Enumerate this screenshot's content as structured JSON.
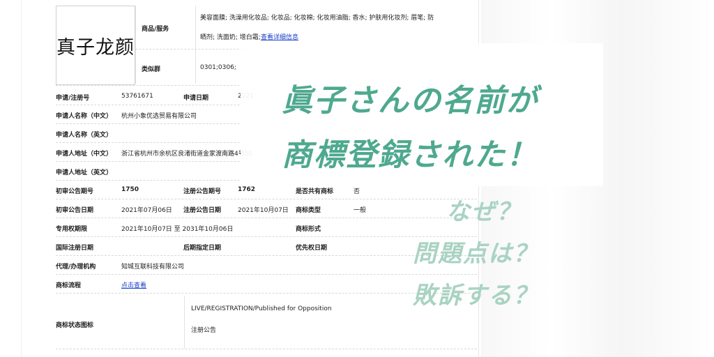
{
  "document": {
    "logo_text": "真子龙颜",
    "goods_label": "商品/服务",
    "goods_value_line1": "美容面膜; 洗澡用化妆品; 化妆品; 化妆棉; 化妆用油脂; 香水; 护肤用化妆剂; 眉笔; 防",
    "goods_value_line2": "晒剂; 洗面奶; 增白霜;",
    "goods_link": "查看详细信息",
    "class_label": "类似群",
    "class_value": "0301;0306;",
    "reg_no_label": "申请/注册号",
    "reg_no_value": "53761671",
    "app_date_label": "申请日期",
    "app_date_value": "2021",
    "applicant_cn_label": "申请人名称（中文）",
    "applicant_cn_value": "杭州小象优选贸易有限公司",
    "applicant_en_label": "申请人名称（英文）",
    "address_cn_label": "申请人地址（中文）",
    "address_cn_value": "浙江省杭州市余杭区良渚街道金家渡南路4号50",
    "address_en_label": "申请人地址（英文）",
    "prelim_no_label": "初审公告期号",
    "prelim_no_value": "1750",
    "reg_pub_no_label": "注册公告期号",
    "reg_pub_no_value": "1762",
    "shared_label": "是否共有商标",
    "shared_value": "否",
    "prelim_date_label": "初审公告日期",
    "prelim_date_value": "2021年07月06日",
    "reg_pub_date_label": "注册公告日期",
    "reg_pub_date_value": "2021年10月07日",
    "type_label": "商标类型",
    "type_value": "一般",
    "exclusive_label": "专用权期限",
    "exclusive_value": "2021年10月07日 至 2031年10月06日",
    "form_label": "商标形式",
    "intl_date_label": "国际注册日期",
    "later_date_label": "后期指定日期",
    "priority_label": "优先权日期",
    "agent_label": "代理/办理机构",
    "agent_value": "知城互联科技有限公司",
    "process_label": "商标流程",
    "process_link": "点击查看",
    "status_label": "商标状态图标",
    "status_value_line1": "LIVE/REGISTRATION/Published for Opposition",
    "status_value_line2": "注册公告"
  },
  "overlay": {
    "headline_line1": "眞子さんの名前が",
    "headline_line2": "商標登録された！",
    "sub_line1": "なぜ？",
    "sub_line2": "問題点は？",
    "sub_line3": "敗訴する？",
    "headline_color": "#4ea98e",
    "sub_color": "#a9d3c3"
  }
}
